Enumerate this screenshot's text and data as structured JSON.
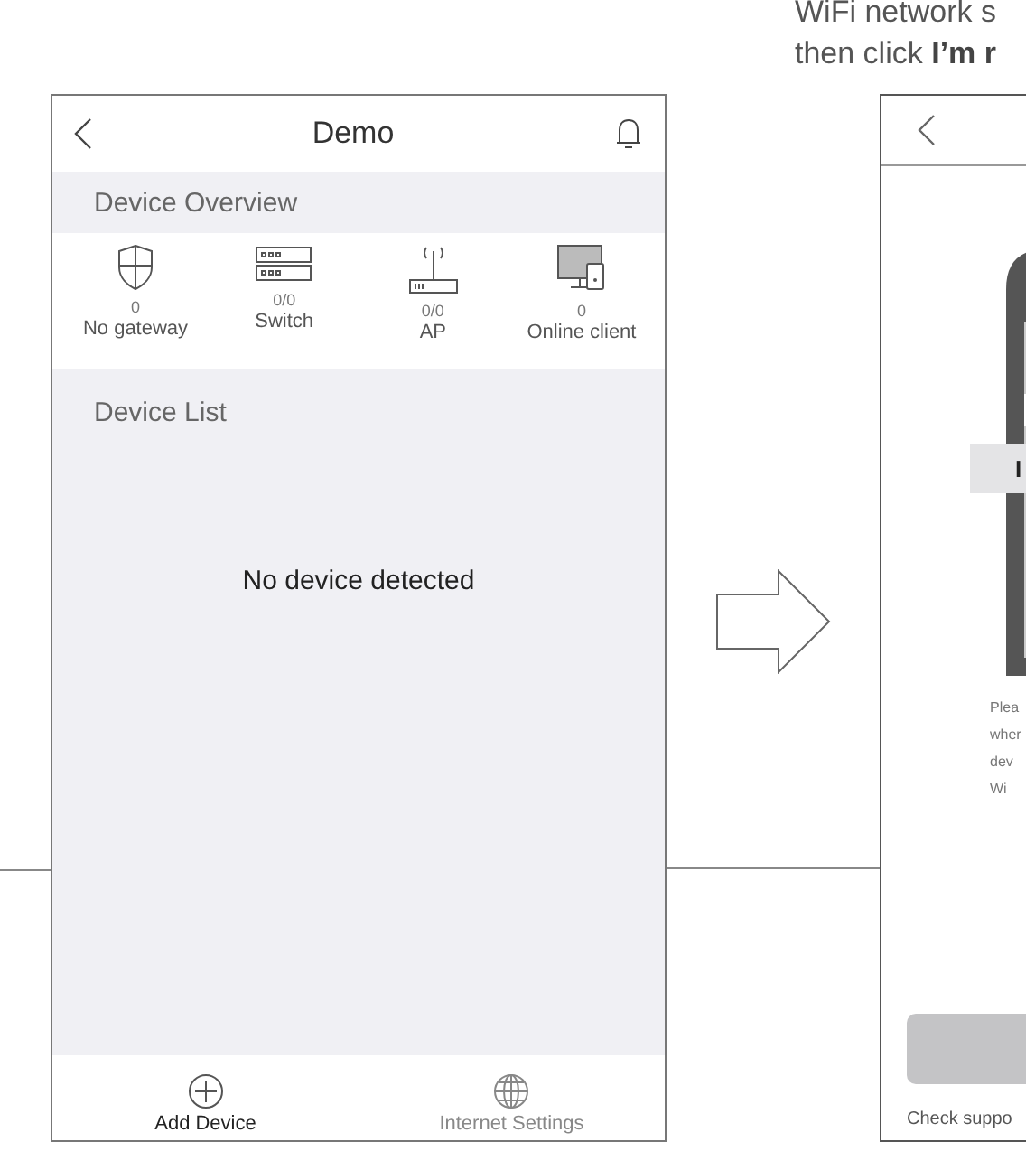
{
  "caption": [
    "WiFi network s",
    "then click **I’m r**"
  ],
  "left_screen": {
    "title": "Demo",
    "overview_heading": "Device Overview",
    "overview": [
      {
        "kind": "gateway",
        "count": "0",
        "label": "No gateway"
      },
      {
        "kind": "switch",
        "count": "0/0",
        "label": "Switch"
      },
      {
        "kind": "ap",
        "count": "0/0",
        "label": "AP"
      },
      {
        "kind": "client",
        "count": "0",
        "label": "Online client"
      }
    ],
    "list_heading": "Device List",
    "empty_message": "No device detected",
    "tabs": [
      {
        "kind": "add",
        "label": "Add Device",
        "selected": true
      },
      {
        "kind": "internet",
        "label": "Internet Settings",
        "selected": false
      }
    ]
  },
  "right_screen": {
    "overlay_label": "I",
    "instructions": [
      "Plea",
      "wher",
      "dev",
      "Wi"
    ],
    "footer": "Check suppo"
  }
}
